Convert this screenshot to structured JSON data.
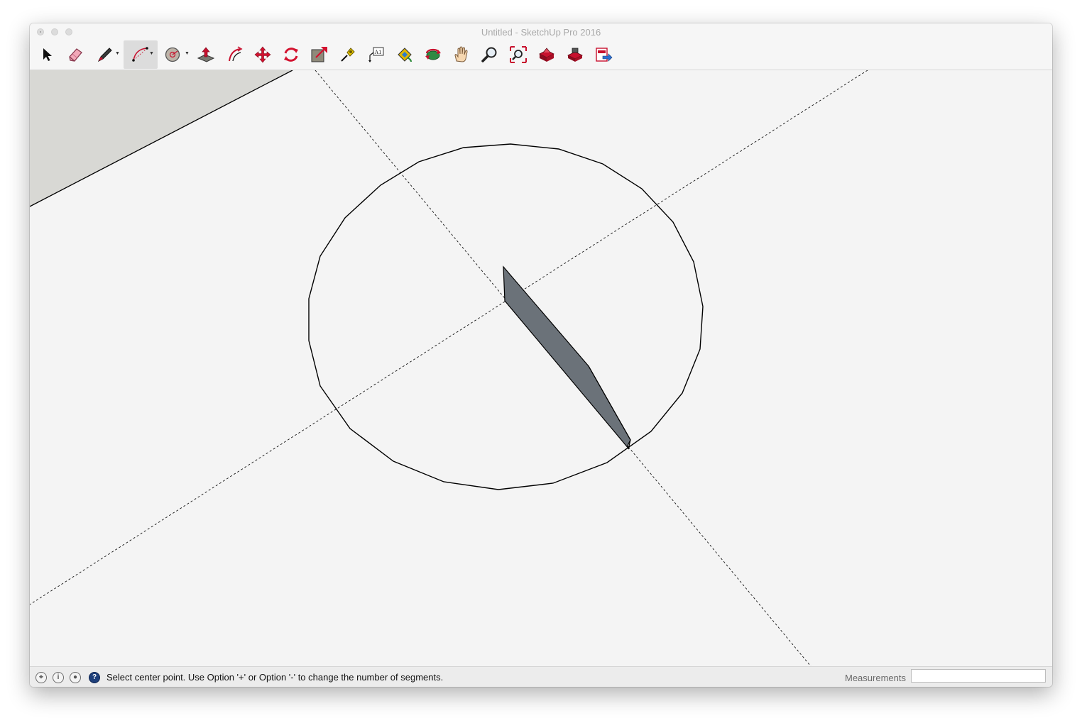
{
  "window": {
    "title": "Untitled - SketchUp Pro 2016"
  },
  "toolbar": {
    "tools": [
      {
        "id": "select",
        "icon": "select-arrow-icon"
      },
      {
        "id": "eraser",
        "icon": "eraser-icon"
      },
      {
        "id": "line",
        "icon": "pencil-line-icon",
        "dropdown": true
      },
      {
        "id": "arc",
        "icon": "arc-icon",
        "dropdown": true,
        "active": true
      },
      {
        "id": "shapes",
        "icon": "circle-shape-icon",
        "dropdown": true
      },
      {
        "id": "push-pull",
        "icon": "push-pull-icon"
      },
      {
        "id": "offset",
        "icon": "offset-icon"
      },
      {
        "id": "move",
        "icon": "move-icon"
      },
      {
        "id": "rotate",
        "icon": "rotate-icon"
      },
      {
        "id": "scale",
        "icon": "scale-icon"
      },
      {
        "id": "tape-measure",
        "icon": "tape-measure-icon"
      },
      {
        "id": "text",
        "icon": "text-label-icon",
        "label": "A1"
      },
      {
        "id": "paint-bucket",
        "icon": "paint-bucket-icon"
      },
      {
        "id": "orbit",
        "icon": "orbit-icon"
      },
      {
        "id": "pan",
        "icon": "pan-hand-icon"
      },
      {
        "id": "zoom",
        "icon": "zoom-magnifier-icon"
      },
      {
        "id": "zoom-extents",
        "icon": "zoom-extents-icon"
      },
      {
        "id": "warehouse",
        "icon": "3d-warehouse-icon"
      },
      {
        "id": "extension-warehouse",
        "icon": "extension-warehouse-icon"
      },
      {
        "id": "send-to-layout",
        "icon": "send-to-layout-icon"
      }
    ],
    "accent_color": "#c8102e"
  },
  "status": {
    "icons": [
      "geo-location-icon",
      "credits-info-icon",
      "user-account-icon",
      "help-icon"
    ],
    "message": "Select center point. Use Option '+' or Option '-' to change the number of segments.",
    "measurements_label": "Measurements",
    "measurements_value": ""
  },
  "canvas": {
    "background": "#f4f4f4",
    "ground_color": "#d8d8d4",
    "face_color": "#6b7279",
    "edge_color": "#000000"
  }
}
